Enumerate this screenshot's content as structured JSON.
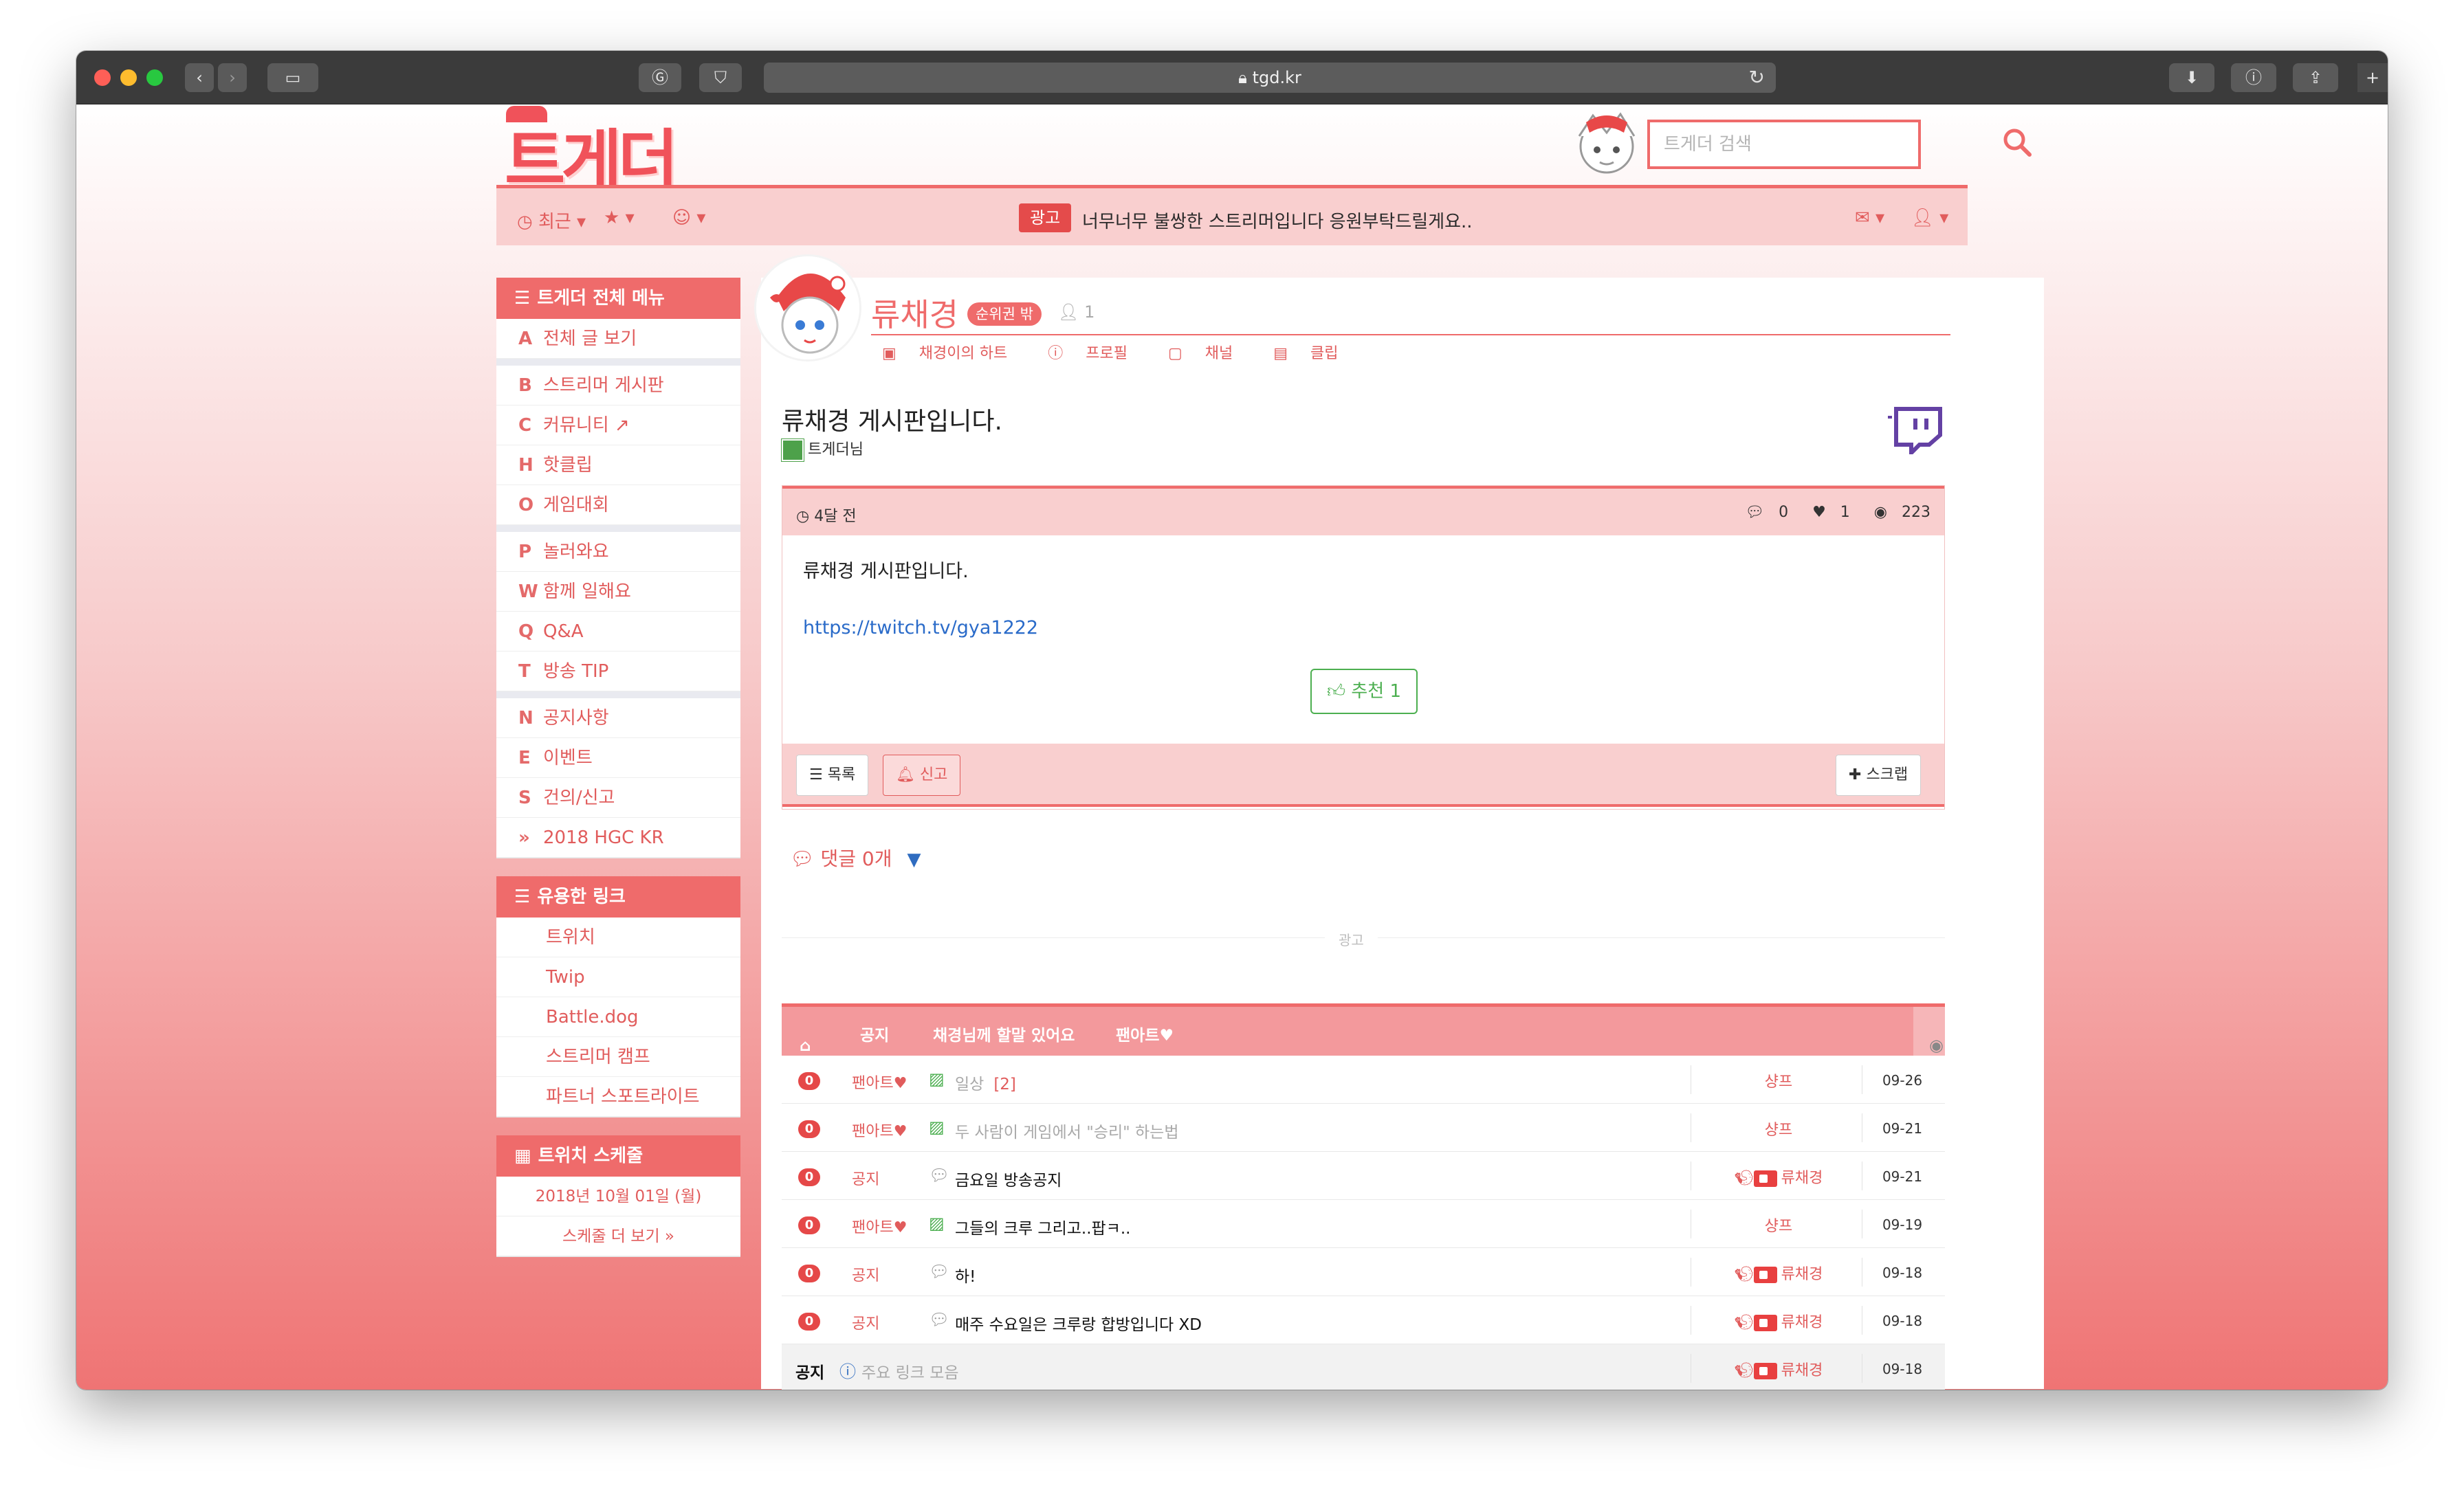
{
  "browser": {
    "url": "tgd.kr"
  },
  "site": {
    "logo": "트게더",
    "search_placeholder": "트게더 검색",
    "nav": {
      "recent": "최근",
      "ad_badge": "광고",
      "ad_text": "너무너무 불쌍한 스트리머입니다 응원부탁드릴게요.."
    }
  },
  "sidebar": {
    "menu_title": "트게더 전체 메뉴",
    "menu": [
      {
        "key": "A",
        "label": "전체 글 보기"
      },
      {
        "key": "B",
        "label": "스트리머 게시판"
      },
      {
        "key": "C",
        "label": "커뮤니티"
      },
      {
        "key": "H",
        "label": "핫클립"
      },
      {
        "key": "O",
        "label": "게임대회"
      },
      {
        "key": "P",
        "label": "놀러와요"
      },
      {
        "key": "W",
        "label": "함께 일해요"
      },
      {
        "key": "Q",
        "label": "Q&A"
      },
      {
        "key": "T",
        "label": "방송 TIP"
      },
      {
        "key": "N",
        "label": "공지사항"
      },
      {
        "key": "E",
        "label": "이벤트"
      },
      {
        "key": "S",
        "label": "건의/신고"
      },
      {
        "key": "»",
        "label": "2018 HGC KR"
      }
    ],
    "links_title": "유용한 링크",
    "links": [
      "트위치",
      "Twip",
      "Battle.dog",
      "스트리머 캠프",
      "파트너 스포트라이트"
    ],
    "schedule_title": "트위치 스케줄",
    "schedule_date": "2018년 10월 01일 (월)",
    "schedule_more": "스케줄 더 보기 »"
  },
  "profile": {
    "name": "류채경",
    "rank": "순위권 밖",
    "followers": "1",
    "links": [
      "채경이의 하트",
      "프로필",
      "채널",
      "클립"
    ]
  },
  "post": {
    "title": "류채경 게시판입니다.",
    "author": "트게더님",
    "time": "4달 전",
    "comments": "0",
    "likes": "1",
    "views": "223",
    "body": "류채경 게시판입니다.",
    "link": "https://twitch.tv/gya1222",
    "like_button": "추천 1",
    "list_button": "목록",
    "report_button": "신고",
    "scrap_button": "스크랩"
  },
  "comments_label": "댓글 0개",
  "ad_divider": "광고",
  "board": {
    "tabs": [
      "공지",
      "채경님께 할말 있어요",
      "팬아트♥"
    ],
    "rows": [
      {
        "count": "0",
        "category": "팬아트♥",
        "type": "image",
        "title": "일상",
        "reply": "[2]",
        "title_gray": true,
        "writer": "샹프",
        "writer_badges": false,
        "date": "09-26"
      },
      {
        "count": "0",
        "category": "팬아트♥",
        "type": "image",
        "title": "두 사람이 게임에서 \"승리\" 하는법",
        "reply": "",
        "title_gray": true,
        "writer": "샹프",
        "writer_badges": false,
        "date": "09-21"
      },
      {
        "count": "0",
        "category": "공지",
        "type": "text",
        "title": "금요일 방송공지",
        "reply": "",
        "title_gray": false,
        "writer": "류채경",
        "writer_badges": true,
        "date": "09-21"
      },
      {
        "count": "0",
        "category": "팬아트♥",
        "type": "image",
        "title": "그들의 크루 그리고..팝ㅋ..",
        "reply": "",
        "title_gray": false,
        "writer": "샹프",
        "writer_badges": false,
        "date": "09-19"
      },
      {
        "count": "0",
        "category": "공지",
        "type": "text",
        "title": "하!",
        "reply": "",
        "title_gray": false,
        "writer": "류채경",
        "writer_badges": true,
        "date": "09-18"
      },
      {
        "count": "0",
        "category": "공지",
        "type": "text",
        "title": "매주 수요일은 크루랑 합방입니다 XD",
        "reply": "",
        "title_gray": false,
        "writer": "류채경",
        "writer_badges": true,
        "date": "09-18"
      }
    ],
    "notice_row": {
      "label": "공지",
      "title": "주요 링크 모음",
      "writer": "류채경",
      "date": "09-18"
    }
  },
  "colors": {
    "accent": "#ef6b6b",
    "accent_light": "#f9cfcf",
    "link": "#2a6bc9",
    "like": "#4caf50"
  }
}
